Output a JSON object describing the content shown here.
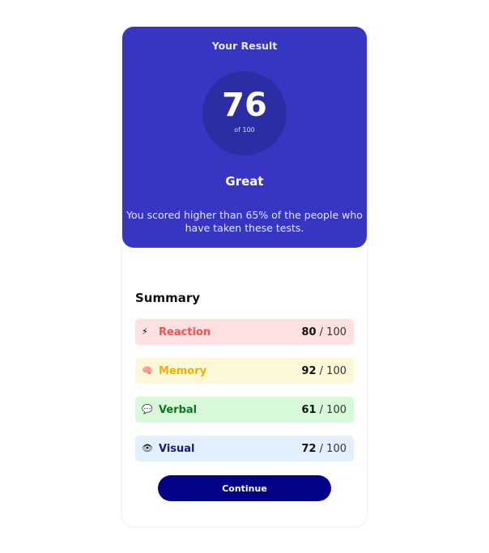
{
  "result": {
    "title": "Your Result",
    "score": "76",
    "score_max": "of 100",
    "rating": "Great",
    "description": "You scored higher than 65% of the people who have taken these tests."
  },
  "summary": {
    "title": "Summary",
    "items": [
      {
        "icon": "lightning-bolt-icon",
        "label": "Reaction",
        "score": "80",
        "max": " / 100",
        "color": "#f55050"
      },
      {
        "icon": "brain-icon",
        "label": "Memory",
        "score": "92",
        "max": " / 100",
        "color": "#f0b000"
      },
      {
        "icon": "speech-bubble-icon",
        "label": "Verbal",
        "score": "61",
        "max": " / 100",
        "color": "#0a7a18"
      },
      {
        "icon": "eye-icon",
        "label": "Visual",
        "score": "72",
        "max": " / 100",
        "color": "#1a1a80"
      }
    ]
  },
  "actions": {
    "continue_label": "Continue",
    "button_color": "#040388"
  },
  "colors": {
    "result_bg": "#3636c2"
  }
}
